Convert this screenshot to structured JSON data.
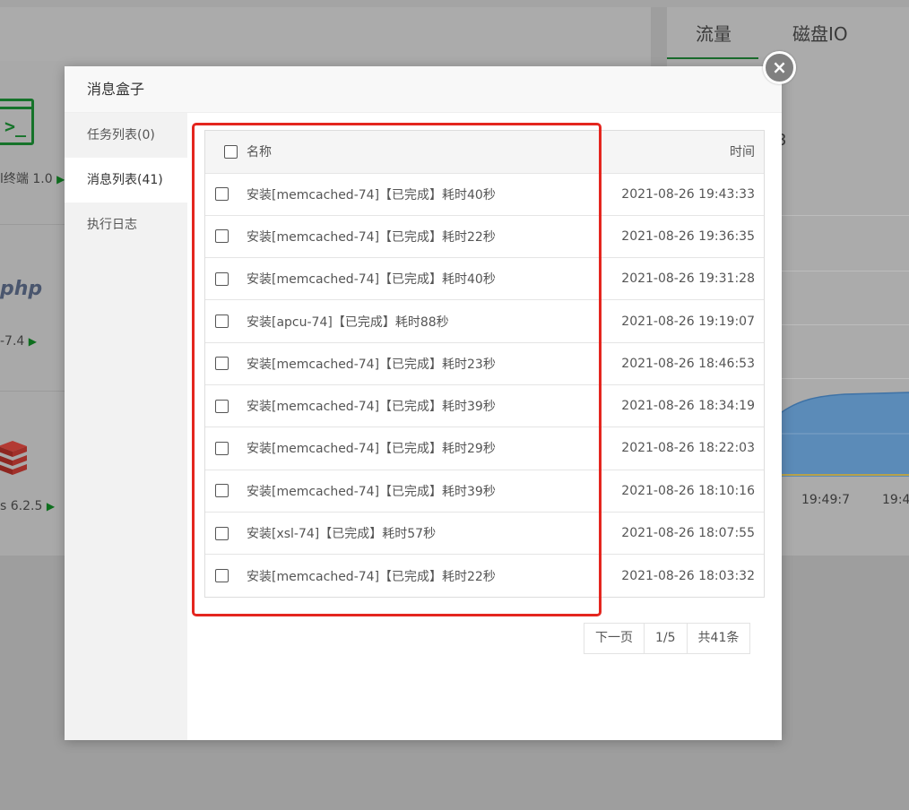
{
  "background": {
    "tabs": [
      "流量",
      "磁盘IO"
    ],
    "chart_partial_value": "3",
    "apps": [
      {
        "label": "l终端 1.0"
      },
      {
        "label": "php",
        "version": "-7.4"
      },
      {
        "label": "s 6.2.5"
      }
    ],
    "chart_ticks": [
      "19:49:7",
      "19:4"
    ]
  },
  "modal": {
    "title": "消息盒子",
    "close_icon": "×",
    "sidebar": [
      {
        "label": "任务列表(0)",
        "active": false
      },
      {
        "label": "消息列表(41)",
        "active": true
      },
      {
        "label": "执行日志",
        "active": false
      }
    ],
    "table": {
      "headers": {
        "name": "名称",
        "time": "时间"
      },
      "rows": [
        {
          "name": "安装[memcached-74]【已完成】耗时40秒",
          "time": "2021-08-26 19:43:33"
        },
        {
          "name": "安装[memcached-74]【已完成】耗时22秒",
          "time": "2021-08-26 19:36:35"
        },
        {
          "name": "安装[memcached-74]【已完成】耗时40秒",
          "time": "2021-08-26 19:31:28"
        },
        {
          "name": "安装[apcu-74]【已完成】耗时88秒",
          "time": "2021-08-26 19:19:07"
        },
        {
          "name": "安装[memcached-74]【已完成】耗时23秒",
          "time": "2021-08-26 18:46:53"
        },
        {
          "name": "安装[memcached-74]【已完成】耗时39秒",
          "time": "2021-08-26 18:34:19"
        },
        {
          "name": "安装[memcached-74]【已完成】耗时29秒",
          "time": "2021-08-26 18:22:03"
        },
        {
          "name": "安装[memcached-74]【已完成】耗时39秒",
          "time": "2021-08-26 18:10:16"
        },
        {
          "name": "安装[xsl-74]【已完成】耗时57秒",
          "time": "2021-08-26 18:07:55"
        },
        {
          "name": "安装[memcached-74]【已完成】耗时22秒",
          "time": "2021-08-26 18:03:32"
        }
      ]
    },
    "pager": {
      "next": "下一页",
      "page": "1/5",
      "total": "共41条"
    }
  },
  "colors": {
    "highlight": "#e4261f",
    "brand_green": "#16732a"
  }
}
